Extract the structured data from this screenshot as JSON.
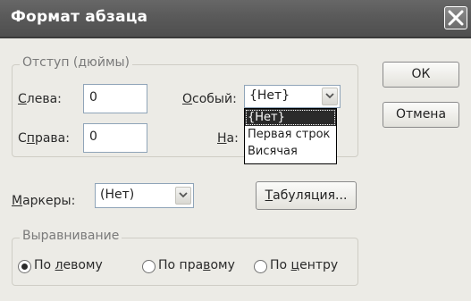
{
  "dialog": {
    "title": "Формат абзаца",
    "ok_label": "ОК",
    "cancel_label": "Отмена"
  },
  "indent": {
    "legend": "Отступ (дюймы)",
    "left_label_ul": "С",
    "left_label_rest": "лева:",
    "left_value": "0",
    "right_label_pre": "С",
    "right_label_ul": "п",
    "right_label_rest": "рава:",
    "right_value": "0",
    "special_label_ul": "О",
    "special_label_rest": "собый:",
    "special_value": "{Нет}",
    "by_label_ul": "Н",
    "by_label_rest": "а:",
    "special_options": [
      "{Нет}",
      "Первая строк",
      "Висячая"
    ],
    "special_selected_index": 0
  },
  "markers": {
    "label_ul": "М",
    "label_rest": "аркеры:",
    "value": "(Нет)"
  },
  "tabs_button": {
    "label_ul": "Т",
    "label_rest": "абуляция..."
  },
  "alignment": {
    "legend": "Выравнивание",
    "options": [
      {
        "pre": "По ",
        "ul": "л",
        "rest": "евому",
        "selected": true
      },
      {
        "pre": "По пра",
        "ul": "в",
        "rest": "ому",
        "selected": false
      },
      {
        "pre": "По ",
        "ul": "ц",
        "rest": "ентру",
        "selected": false
      }
    ]
  }
}
